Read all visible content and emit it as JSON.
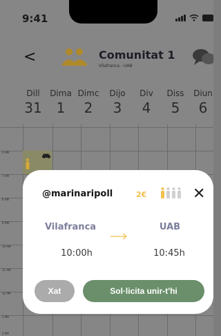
{
  "status_bar": {
    "time": "9:41"
  },
  "header": {
    "title": "Comunitat 1",
    "subtitle": "Vilafranca - UAB",
    "icons": {
      "back": "chevron-left-icon",
      "group": "group-icon",
      "chat": "chat-bubbles-icon"
    }
  },
  "calendar": {
    "days": [
      {
        "name": "Dill",
        "date": "31"
      },
      {
        "name": "Dima",
        "date": "1"
      },
      {
        "name": "Dimc",
        "date": "2"
      },
      {
        "name": "Dijo",
        "date": "3"
      },
      {
        "name": "Div",
        "date": "4"
      },
      {
        "name": "Diss",
        "date": "5"
      },
      {
        "name": "Diun",
        "date": "6"
      }
    ],
    "hours": [
      "6 AM",
      "7 AM",
      "8 AM",
      "9 AM",
      "10 AM",
      "11 AM",
      "12 PM",
      "1 PM",
      "2 PM"
    ]
  },
  "ride_card": {
    "username": "@marinaripoll",
    "price": "2€",
    "seats_total": 4,
    "seats_taken": 1,
    "origin": "Vilafranca",
    "destination": "UAB",
    "departure_time": "10:00h",
    "arrival_time": "10:45h",
    "chat_label": "Xat",
    "join_label": "Sol·licita unir-t'hi"
  },
  "colors": {
    "accent_yellow": "#f2c14e",
    "join_green": "#6a8f6a",
    "chat_grey": "#ababab",
    "location_text": "#7c7e9c"
  }
}
